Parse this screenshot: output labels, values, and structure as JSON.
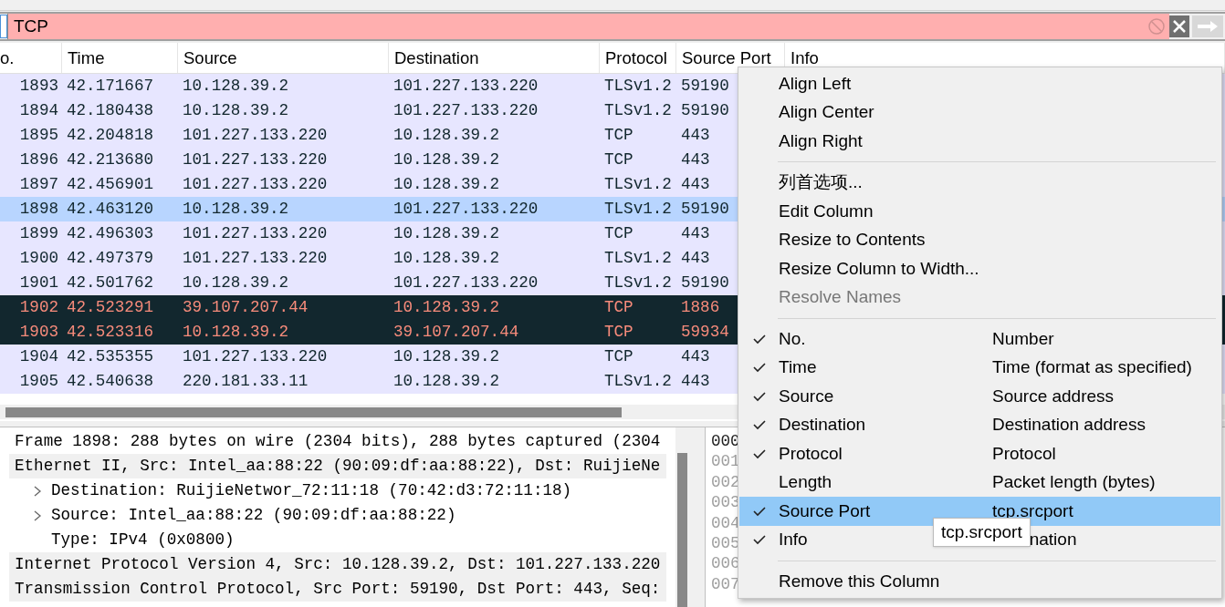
{
  "filter": {
    "value": "TCP"
  },
  "packet_list": {
    "columns": [
      "o.",
      "Time",
      "Source",
      "Destination",
      "Protocol",
      "Source Port",
      "Info"
    ],
    "rows": [
      {
        "no": "1893",
        "time": "42.171667",
        "source": "10.128.39.2",
        "destination": "101.227.133.220",
        "protocol": "TLSv1.2",
        "source_port": "59190",
        "kind": "normal",
        "selected": false
      },
      {
        "no": "1894",
        "time": "42.180438",
        "source": "10.128.39.2",
        "destination": "101.227.133.220",
        "protocol": "TLSv1.2",
        "source_port": "59190",
        "kind": "normal",
        "selected": false
      },
      {
        "no": "1895",
        "time": "42.204818",
        "source": "101.227.133.220",
        "destination": "10.128.39.2",
        "protocol": "TCP",
        "source_port": "443",
        "kind": "normal",
        "selected": false
      },
      {
        "no": "1896",
        "time": "42.213680",
        "source": "101.227.133.220",
        "destination": "10.128.39.2",
        "protocol": "TCP",
        "source_port": "443",
        "kind": "normal",
        "selected": false
      },
      {
        "no": "1897",
        "time": "42.456901",
        "source": "101.227.133.220",
        "destination": "10.128.39.2",
        "protocol": "TLSv1.2",
        "source_port": "443",
        "kind": "normal",
        "selected": false
      },
      {
        "no": "1898",
        "time": "42.463120",
        "source": "10.128.39.2",
        "destination": "101.227.133.220",
        "protocol": "TLSv1.2",
        "source_port": "59190",
        "kind": "normal",
        "selected": true
      },
      {
        "no": "1899",
        "time": "42.496303",
        "source": "101.227.133.220",
        "destination": "10.128.39.2",
        "protocol": "TCP",
        "source_port": "443",
        "kind": "normal",
        "selected": false
      },
      {
        "no": "1900",
        "time": "42.497379",
        "source": "101.227.133.220",
        "destination": "10.128.39.2",
        "protocol": "TLSv1.2",
        "source_port": "443",
        "kind": "normal",
        "selected": false
      },
      {
        "no": "1901",
        "time": "42.501762",
        "source": "10.128.39.2",
        "destination": "101.227.133.220",
        "protocol": "TLSv1.2",
        "source_port": "59190",
        "kind": "normal",
        "selected": false
      },
      {
        "no": "1902",
        "time": "42.523291",
        "source": "39.107.207.44",
        "destination": "10.128.39.2",
        "protocol": "TCP",
        "source_port": "1886",
        "kind": "bad",
        "selected": false
      },
      {
        "no": "1903",
        "time": "42.523316",
        "source": "10.128.39.2",
        "destination": "39.107.207.44",
        "protocol": "TCP",
        "source_port": "59934",
        "kind": "bad",
        "selected": false
      },
      {
        "no": "1904",
        "time": "42.535355",
        "source": "101.227.133.220",
        "destination": "10.128.39.2",
        "protocol": "TCP",
        "source_port": "443",
        "kind": "normal",
        "selected": false
      },
      {
        "no": "1905",
        "time": "42.540638",
        "source": "220.181.33.11",
        "destination": "10.128.39.2",
        "protocol": "TLSv1.2",
        "source_port": "443",
        "kind": "normal",
        "selected": false
      }
    ]
  },
  "packet_details": [
    {
      "text": "Frame 1898: 288 bytes on wire (2304 bits), 288 bytes captured (2304",
      "highlighted": false
    },
    {
      "text": "Ethernet II, Src: Intel_aa:88:22 (90:09:df:aa:88:22), Dst: RuijieNe",
      "highlighted": true,
      "children": [
        {
          "text": "Destination: RuijieNetwor_72:11:18 (70:42:d3:72:11:18)",
          "expandable": true
        },
        {
          "text": "Source: Intel_aa:88:22 (90:09:df:aa:88:22)",
          "expandable": true
        },
        {
          "text": "Type: IPv4 (0x0800)",
          "expandable": false
        }
      ]
    },
    {
      "text": "Internet Protocol Version 4, Src: 10.128.39.2, Dst: 101.227.133.220",
      "highlighted": true
    },
    {
      "text": "Transmission Control Protocol, Src Port: 59190, Dst Port: 443, Seq:",
      "highlighted": true
    }
  ],
  "hex_offsets": [
    {
      "text": "000",
      "selected": true
    },
    {
      "text": "001",
      "selected": false
    },
    {
      "text": "002",
      "selected": false
    },
    {
      "text": "003",
      "selected": false
    },
    {
      "text": "004",
      "selected": false
    },
    {
      "text": "005",
      "selected": false
    },
    {
      "text": "006",
      "selected": false
    },
    {
      "text": "007",
      "selected": false
    }
  ],
  "context_menu": {
    "items": [
      {
        "kind": "action",
        "label": "Align Left",
        "disabled": false
      },
      {
        "kind": "action",
        "label": "Align Center",
        "disabled": false
      },
      {
        "kind": "action",
        "label": "Align Right",
        "disabled": false
      },
      {
        "kind": "separator"
      },
      {
        "kind": "action",
        "label": "列首选项...",
        "disabled": false
      },
      {
        "kind": "action",
        "label": "Edit Column",
        "disabled": false
      },
      {
        "kind": "action",
        "label": "Resize to Contents",
        "disabled": false
      },
      {
        "kind": "action",
        "label": "Resize Column to Width...",
        "disabled": false
      },
      {
        "kind": "action",
        "label": "Resolve Names",
        "disabled": true
      },
      {
        "kind": "separator"
      },
      {
        "kind": "column",
        "label": "No.",
        "description": "Number",
        "checked": true,
        "selected": false
      },
      {
        "kind": "column",
        "label": "Time",
        "description": "Time (format as specified)",
        "checked": true,
        "selected": false
      },
      {
        "kind": "column",
        "label": "Source",
        "description": "Source address",
        "checked": true,
        "selected": false
      },
      {
        "kind": "column",
        "label": "Destination",
        "description": "Destination address",
        "checked": true,
        "selected": false
      },
      {
        "kind": "column",
        "label": "Protocol",
        "description": "Protocol",
        "checked": true,
        "selected": false
      },
      {
        "kind": "column",
        "label": "Length",
        "description": "Packet length (bytes)",
        "checked": false,
        "selected": false
      },
      {
        "kind": "column",
        "label": "Source Port",
        "description": "tcp.srcport",
        "checked": true,
        "selected": true
      },
      {
        "kind": "column",
        "label": "Info",
        "description": "nation",
        "checked": true,
        "selected": false,
        "partly_hidden": true
      },
      {
        "kind": "separator"
      },
      {
        "kind": "action",
        "label": "Remove this Column",
        "disabled": false
      }
    ]
  },
  "tooltip": {
    "text": "tcp.srcport"
  }
}
